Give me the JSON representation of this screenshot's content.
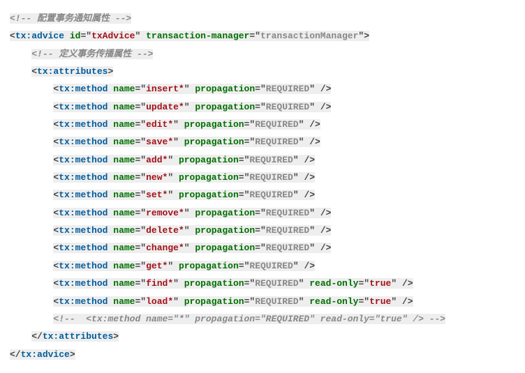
{
  "comments": {
    "top": "配置事务通知属性",
    "inner": "定义事务传播属性",
    "commentedOut": "<tx:method name=\"*\" propagation=\"REQUIRED\" read-only=\"true\" />"
  },
  "tags": {
    "advice": "tx:advice",
    "attributes": "tx:attributes",
    "method": "tx:method"
  },
  "advice": {
    "idAttr": "id",
    "idVal": "txAdvice",
    "tmAttr": "transaction-manager",
    "tmVal": "transactionManager"
  },
  "attrNames": {
    "name": "name",
    "propagation": "propagation",
    "readOnly": "read-only"
  },
  "methods": [
    {
      "name": "insert*",
      "propagation": "REQUIRED"
    },
    {
      "name": "update*",
      "propagation": "REQUIRED"
    },
    {
      "name": "edit*",
      "propagation": "REQUIRED"
    },
    {
      "name": "save*",
      "propagation": "REQUIRED"
    },
    {
      "name": "add*",
      "propagation": "REQUIRED"
    },
    {
      "name": "new*",
      "propagation": "REQUIRED"
    },
    {
      "name": "set*",
      "propagation": "REQUIRED"
    },
    {
      "name": "remove*",
      "propagation": "REQUIRED"
    },
    {
      "name": "delete*",
      "propagation": "REQUIRED"
    },
    {
      "name": "change*",
      "propagation": "REQUIRED"
    },
    {
      "name": "get*",
      "propagation": "REQUIRED"
    },
    {
      "name": "find*",
      "propagation": "REQUIRED",
      "readOnly": "true"
    },
    {
      "name": "load*",
      "propagation": "REQUIRED",
      "readOnly": "true"
    }
  ]
}
